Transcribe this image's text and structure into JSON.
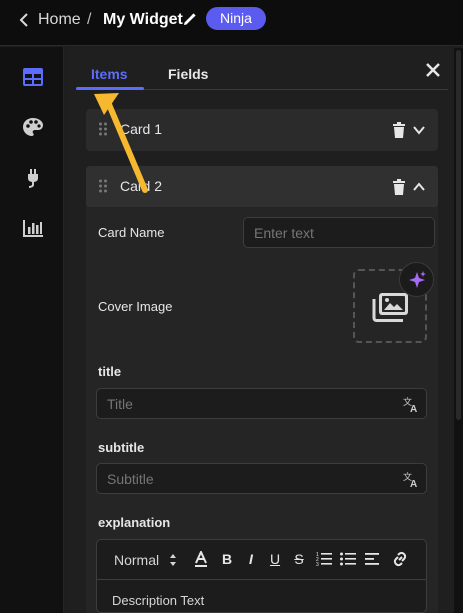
{
  "topbar": {
    "home_label": "Home",
    "separator": "/",
    "widget_title": "My Widget",
    "badge_label": "Ninja"
  },
  "rail": {
    "items": [
      "grid-icon",
      "palette-icon",
      "plug-icon",
      "chart-icon"
    ],
    "active_color": "#5b6cff"
  },
  "tabs": {
    "items_label": "Items",
    "fields_label": "Fields",
    "active_color": "#5b6cff"
  },
  "cards": [
    {
      "title": "Card 1",
      "state": "collapsed"
    },
    {
      "title": "Card 2",
      "state": "expanded"
    }
  ],
  "form": {
    "card_name_label": "Card Name",
    "card_name_placeholder": "Enter text",
    "cover_image_label": "Cover Image",
    "title_label": "title",
    "title_placeholder": "Title",
    "subtitle_label": "subtitle",
    "subtitle_placeholder": "Subtitle",
    "explanation_label": "explanation",
    "toolbar": {
      "format_select": "Normal",
      "bold": "B",
      "italic": "I",
      "underline": "U",
      "strike": "S"
    },
    "description_placeholder": "Description Text"
  }
}
